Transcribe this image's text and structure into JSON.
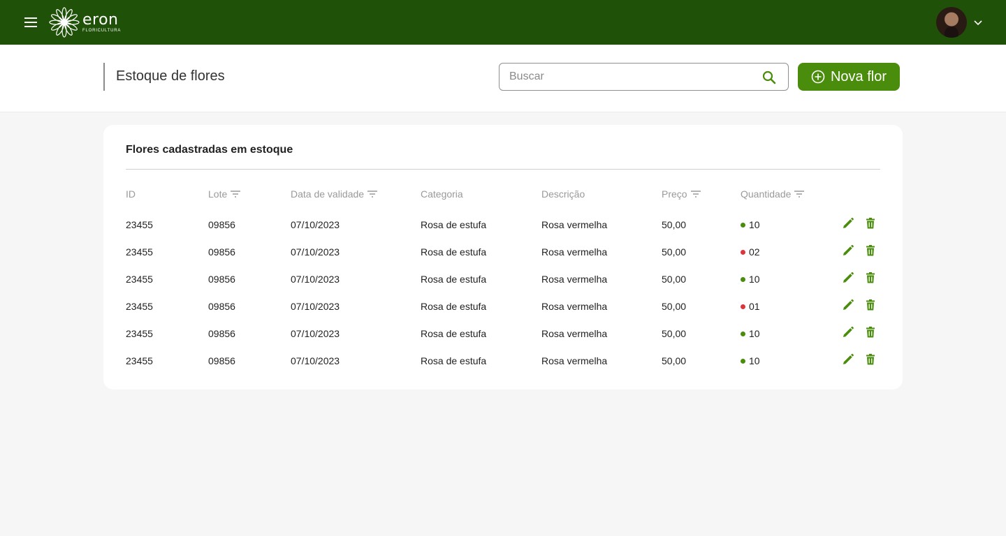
{
  "app": {
    "logo_name": "eron",
    "logo_subtitle": "FLORICULTURA"
  },
  "header": {
    "title": "Estoque de flores",
    "search_placeholder": "Buscar",
    "search_value": "",
    "new_button_label": "Nova flor"
  },
  "card": {
    "title": "Flores cadastradas em estoque",
    "columns": [
      "ID",
      "Lote",
      "Data de validade",
      "Categoria",
      "Descrição",
      "Preço",
      "Quantidade"
    ],
    "rows": [
      {
        "id": "23455",
        "lote": "09856",
        "validade": "07/10/2023",
        "categoria": "Rosa de estufa",
        "descricao": "Rosa vermelha",
        "preco": "50,00",
        "quantidade": "10",
        "status": "ok"
      },
      {
        "id": "23455",
        "lote": "09856",
        "validade": "07/10/2023",
        "categoria": "Rosa de estufa",
        "descricao": "Rosa vermelha",
        "preco": "50,00",
        "quantidade": "02",
        "status": "low"
      },
      {
        "id": "23455",
        "lote": "09856",
        "validade": "07/10/2023",
        "categoria": "Rosa de estufa",
        "descricao": "Rosa vermelha",
        "preco": "50,00",
        "quantidade": "10",
        "status": "ok"
      },
      {
        "id": "23455",
        "lote": "09856",
        "validade": "07/10/2023",
        "categoria": "Rosa de estufa",
        "descricao": "Rosa vermelha",
        "preco": "50,00",
        "quantidade": "01",
        "status": "low"
      },
      {
        "id": "23455",
        "lote": "09856",
        "validade": "07/10/2023",
        "categoria": "Rosa de estufa",
        "descricao": "Rosa vermelha",
        "preco": "50,00",
        "quantidade": "10",
        "status": "ok"
      },
      {
        "id": "23455",
        "lote": "09856",
        "validade": "07/10/2023",
        "categoria": "Rosa de estufa",
        "descricao": "Rosa vermelha",
        "preco": "50,00",
        "quantidade": "10",
        "status": "ok"
      }
    ]
  },
  "icons": {
    "menu": "menu-icon",
    "search": "search-icon",
    "add": "add-circle-icon",
    "filter": "filter-icon",
    "edit": "pencil-icon",
    "delete": "trash-icon",
    "caret": "chevron-down-icon"
  },
  "colors": {
    "topbar": "#1f5208",
    "accent": "#4a8c0b",
    "status_ok": "#4a8c0b",
    "status_low": "#d9363e"
  }
}
